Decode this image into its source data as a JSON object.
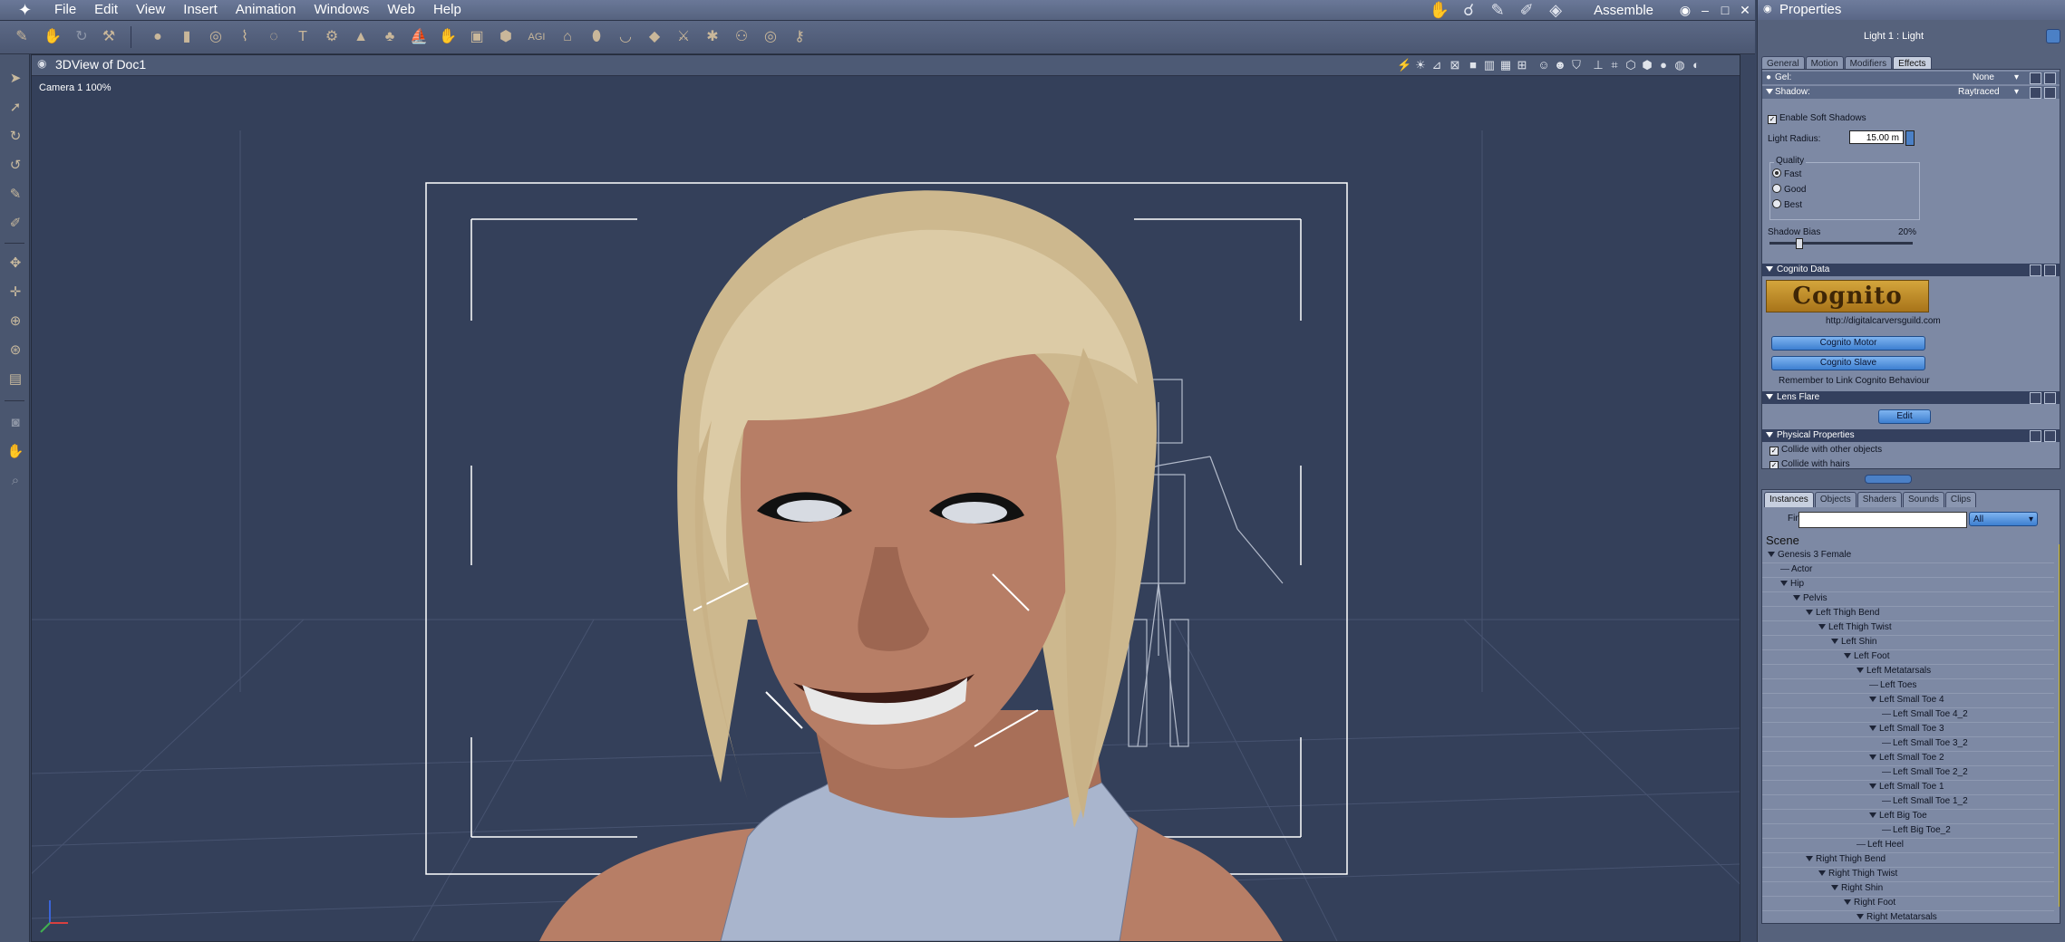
{
  "menubar": {
    "items": [
      "File",
      "Edit",
      "View",
      "Insert",
      "Animation",
      "Windows",
      "Web",
      "Help"
    ],
    "room": "Assemble"
  },
  "viewport": {
    "title": "3DView of Doc1",
    "camera": "Camera 1 100%"
  },
  "properties": {
    "title": "Properties",
    "object": "Light 1 : Light",
    "tabs": [
      "General",
      "Motion",
      "Modifiers",
      "Effects"
    ],
    "active_tab": "Effects",
    "gel_label": "Gel:",
    "gel_value": "None",
    "shadow_label": "Shadow:",
    "shadow_value": "Raytraced",
    "soft_shadows": "Enable Soft Shadows",
    "light_radius_label": "Light Radius:",
    "light_radius_value": "15.00 m",
    "quality_label": "Quality",
    "quality_options": [
      "Fast",
      "Good",
      "Best"
    ],
    "quality_selected": "Fast",
    "shadow_bias_label": "Shadow Bias",
    "shadow_bias_value": "20%",
    "shadow_bias_fraction": 0.2,
    "cognito_section": "Cognito Data",
    "cognito_logo": "Cognito",
    "cognito_url": "http://digitalcarversguild.com",
    "cognito_motor": "Cognito Motor",
    "cognito_slave": "Cognito Slave",
    "cognito_note": "Remember to Link Cognito Behaviour",
    "lens_flare": "Lens Flare",
    "lens_edit": "Edit",
    "physical": "Physical Properties",
    "collide_objects": "Collide with other objects",
    "collide_hairs": "Collide with hairs"
  },
  "scene_panel": {
    "tabs": [
      "Instances",
      "Objects",
      "Shaders",
      "Sounds",
      "Clips"
    ],
    "active_tab": "Instances",
    "find_label": "Find:",
    "find_value": "",
    "filter": "All",
    "header": "Scene",
    "tree": [
      {
        "label": "Genesis 3 Female",
        "depth": 0,
        "expanded": true
      },
      {
        "label": "Actor",
        "depth": 1,
        "expanded": false
      },
      {
        "label": "Hip",
        "depth": 1,
        "expanded": true
      },
      {
        "label": "Pelvis",
        "depth": 2,
        "expanded": true
      },
      {
        "label": "Left Thigh Bend",
        "depth": 3,
        "expanded": true
      },
      {
        "label": "Left Thigh Twist",
        "depth": 4,
        "expanded": true
      },
      {
        "label": "Left Shin",
        "depth": 5,
        "expanded": true
      },
      {
        "label": "Left Foot",
        "depth": 6,
        "expanded": true
      },
      {
        "label": "Left Metatarsals",
        "depth": 7,
        "expanded": true
      },
      {
        "label": "Left Toes",
        "depth": 8,
        "expanded": false
      },
      {
        "label": "Left Small Toe 4",
        "depth": 8,
        "expanded": true
      },
      {
        "label": "Left Small Toe 4_2",
        "depth": 9,
        "expanded": false
      },
      {
        "label": "Left Small Toe 3",
        "depth": 8,
        "expanded": true
      },
      {
        "label": "Left Small Toe 3_2",
        "depth": 9,
        "expanded": false
      },
      {
        "label": "Left Small Toe 2",
        "depth": 8,
        "expanded": true
      },
      {
        "label": "Left Small Toe 2_2",
        "depth": 9,
        "expanded": false
      },
      {
        "label": "Left Small Toe 1",
        "depth": 8,
        "expanded": true
      },
      {
        "label": "Left Small Toe 1_2",
        "depth": 9,
        "expanded": false
      },
      {
        "label": "Left Big Toe",
        "depth": 8,
        "expanded": true
      },
      {
        "label": "Left Big Toe_2",
        "depth": 9,
        "expanded": false
      },
      {
        "label": "Left Heel",
        "depth": 7,
        "expanded": false
      },
      {
        "label": "Right Thigh Bend",
        "depth": 3,
        "expanded": true
      },
      {
        "label": "Right Thigh Twist",
        "depth": 4,
        "expanded": true
      },
      {
        "label": "Right Shin",
        "depth": 5,
        "expanded": true
      },
      {
        "label": "Right Foot",
        "depth": 6,
        "expanded": true
      },
      {
        "label": "Right Metatarsals",
        "depth": 7,
        "expanded": true
      }
    ]
  },
  "colors": {
    "viewport_bg": "#34405a",
    "panel_bg": "#56627c",
    "accent": "#4b80c6",
    "skin": "#b77e66",
    "hair": "#d9c7a0",
    "shirt": "#a8b4cc"
  }
}
